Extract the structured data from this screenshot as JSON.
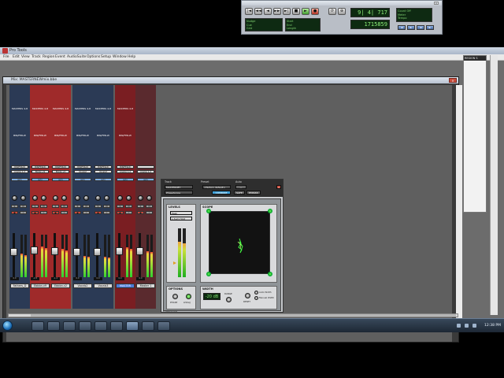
{
  "app": {
    "title": "Pro Tools",
    "menu": [
      "File",
      "Edit",
      "View",
      "Track",
      "Region",
      "Event",
      "AudioSuite",
      "Options",
      "Setup",
      "Window",
      "Help"
    ]
  },
  "transport": {
    "buttons": [
      "◄◄",
      "◄",
      "■",
      "►",
      "►►",
      "●",
      "∣◄",
      "►∣"
    ],
    "counter_main": "9| 4| 717",
    "counter_sub": "1715859",
    "lcd_left": [
      "Nudge",
      "Cue",
      "Grid"
    ],
    "lcd_mid": [
      "Start",
      "End",
      "Length"
    ],
    "lcd_right": [
      "Count Off",
      "Meter",
      "Tempo"
    ],
    "meter_value": "4/4",
    "tempo_value": "120"
  },
  "mix_window": {
    "title": "Mix: MASTERNEWmix.bbe",
    "close_label": "×"
  },
  "channels": [
    {
      "name": "Fathers_D",
      "color": "#2b3a55",
      "insert": "MASTERS 4-8",
      "io": "BIN/FER-W",
      "out": "Analog 1-2",
      "vol": "0.0",
      "pan": "<100 100>",
      "meter": 0.55,
      "fader": 0.58,
      "selected": false
    },
    {
      "name": "Ebbbn.v9",
      "color": "#9f2a2a",
      "insert": "MASTERS 4-8",
      "io": "BIN/FER-W",
      "out": "Ebbbn.v9",
      "vol": "-2.8",
      "pan": "<100 100>",
      "meter": 0.72,
      "fader": 0.62,
      "selected": false
    },
    {
      "name": "Ebbbn.v2",
      "color": "#9f2a2a",
      "insert": "MASTERS 4-8",
      "io": "BIN/FER-W",
      "out": "Ebbbn.v2",
      "vol": "-1.4",
      "pan": "<100 100>",
      "meter": 0.66,
      "fader": 0.6,
      "selected": false
    },
    {
      "name": "Vocals2",
      "color": "#2b3a55",
      "insert": "MASTERS 4-8",
      "io": "BIN/FER-W",
      "out": "Vocals2",
      "vol": "0.0",
      "pan": "<100 100>",
      "meter": 0.5,
      "fader": 0.58,
      "selected": false
    },
    {
      "name": "Vocals3",
      "color": "#2b3a55",
      "insert": "MASTERS 4-8",
      "io": "BIN/FER-W",
      "out": "Vocals3",
      "vol": "0.0",
      "pan": "<100 100>",
      "meter": 0.48,
      "fader": 0.58,
      "selected": false
    },
    {
      "name": "MASTER",
      "color": "#7a1e22",
      "insert": "MASTERS 4-8",
      "io": "BIN/FER-W",
      "out": "Analog 1-2",
      "vol": "0.0",
      "pan": "<100 100>",
      "meter": 0.7,
      "fader": 0.6,
      "selected": true
    },
    {
      "name": "Master 1",
      "color": "#5a2a2e",
      "insert": "",
      "io": "",
      "out": "Analog 1-2",
      "vol": "0.0",
      "pan": "",
      "meter": 0.62,
      "fader": 0.6,
      "selected": false
    }
  ],
  "plugin": {
    "track_label": "Track",
    "preset_label": "Preset",
    "auto_label": "Auto",
    "track_value": "MASTERNEY",
    "preset_value": "<factory default>",
    "plugin_name": "PhaseScope",
    "compare_label": "COMPARE",
    "safe_label": "SAFE",
    "bypass_label": "BYPASS",
    "levels_label": "LEVELS",
    "scope_label": "SCOPE",
    "options_label": "OPTIONS",
    "width_label": "WIDTH",
    "peak_label": "Peak",
    "mode_label": "L-Sum Hold",
    "phase_label": "PHASE",
    "lissajous_label": "LISSAJ",
    "width_value": "-20 dB",
    "ranges_label": "RANGE",
    "reset_label": "RESET",
    "auto_width_label": "Auto Width",
    "manual_width_label": "Manual Width",
    "footer": "PhaseScope"
  },
  "side_window": {
    "title": "REGION S"
  },
  "taskbar": {
    "clock": "12:38 PM"
  }
}
